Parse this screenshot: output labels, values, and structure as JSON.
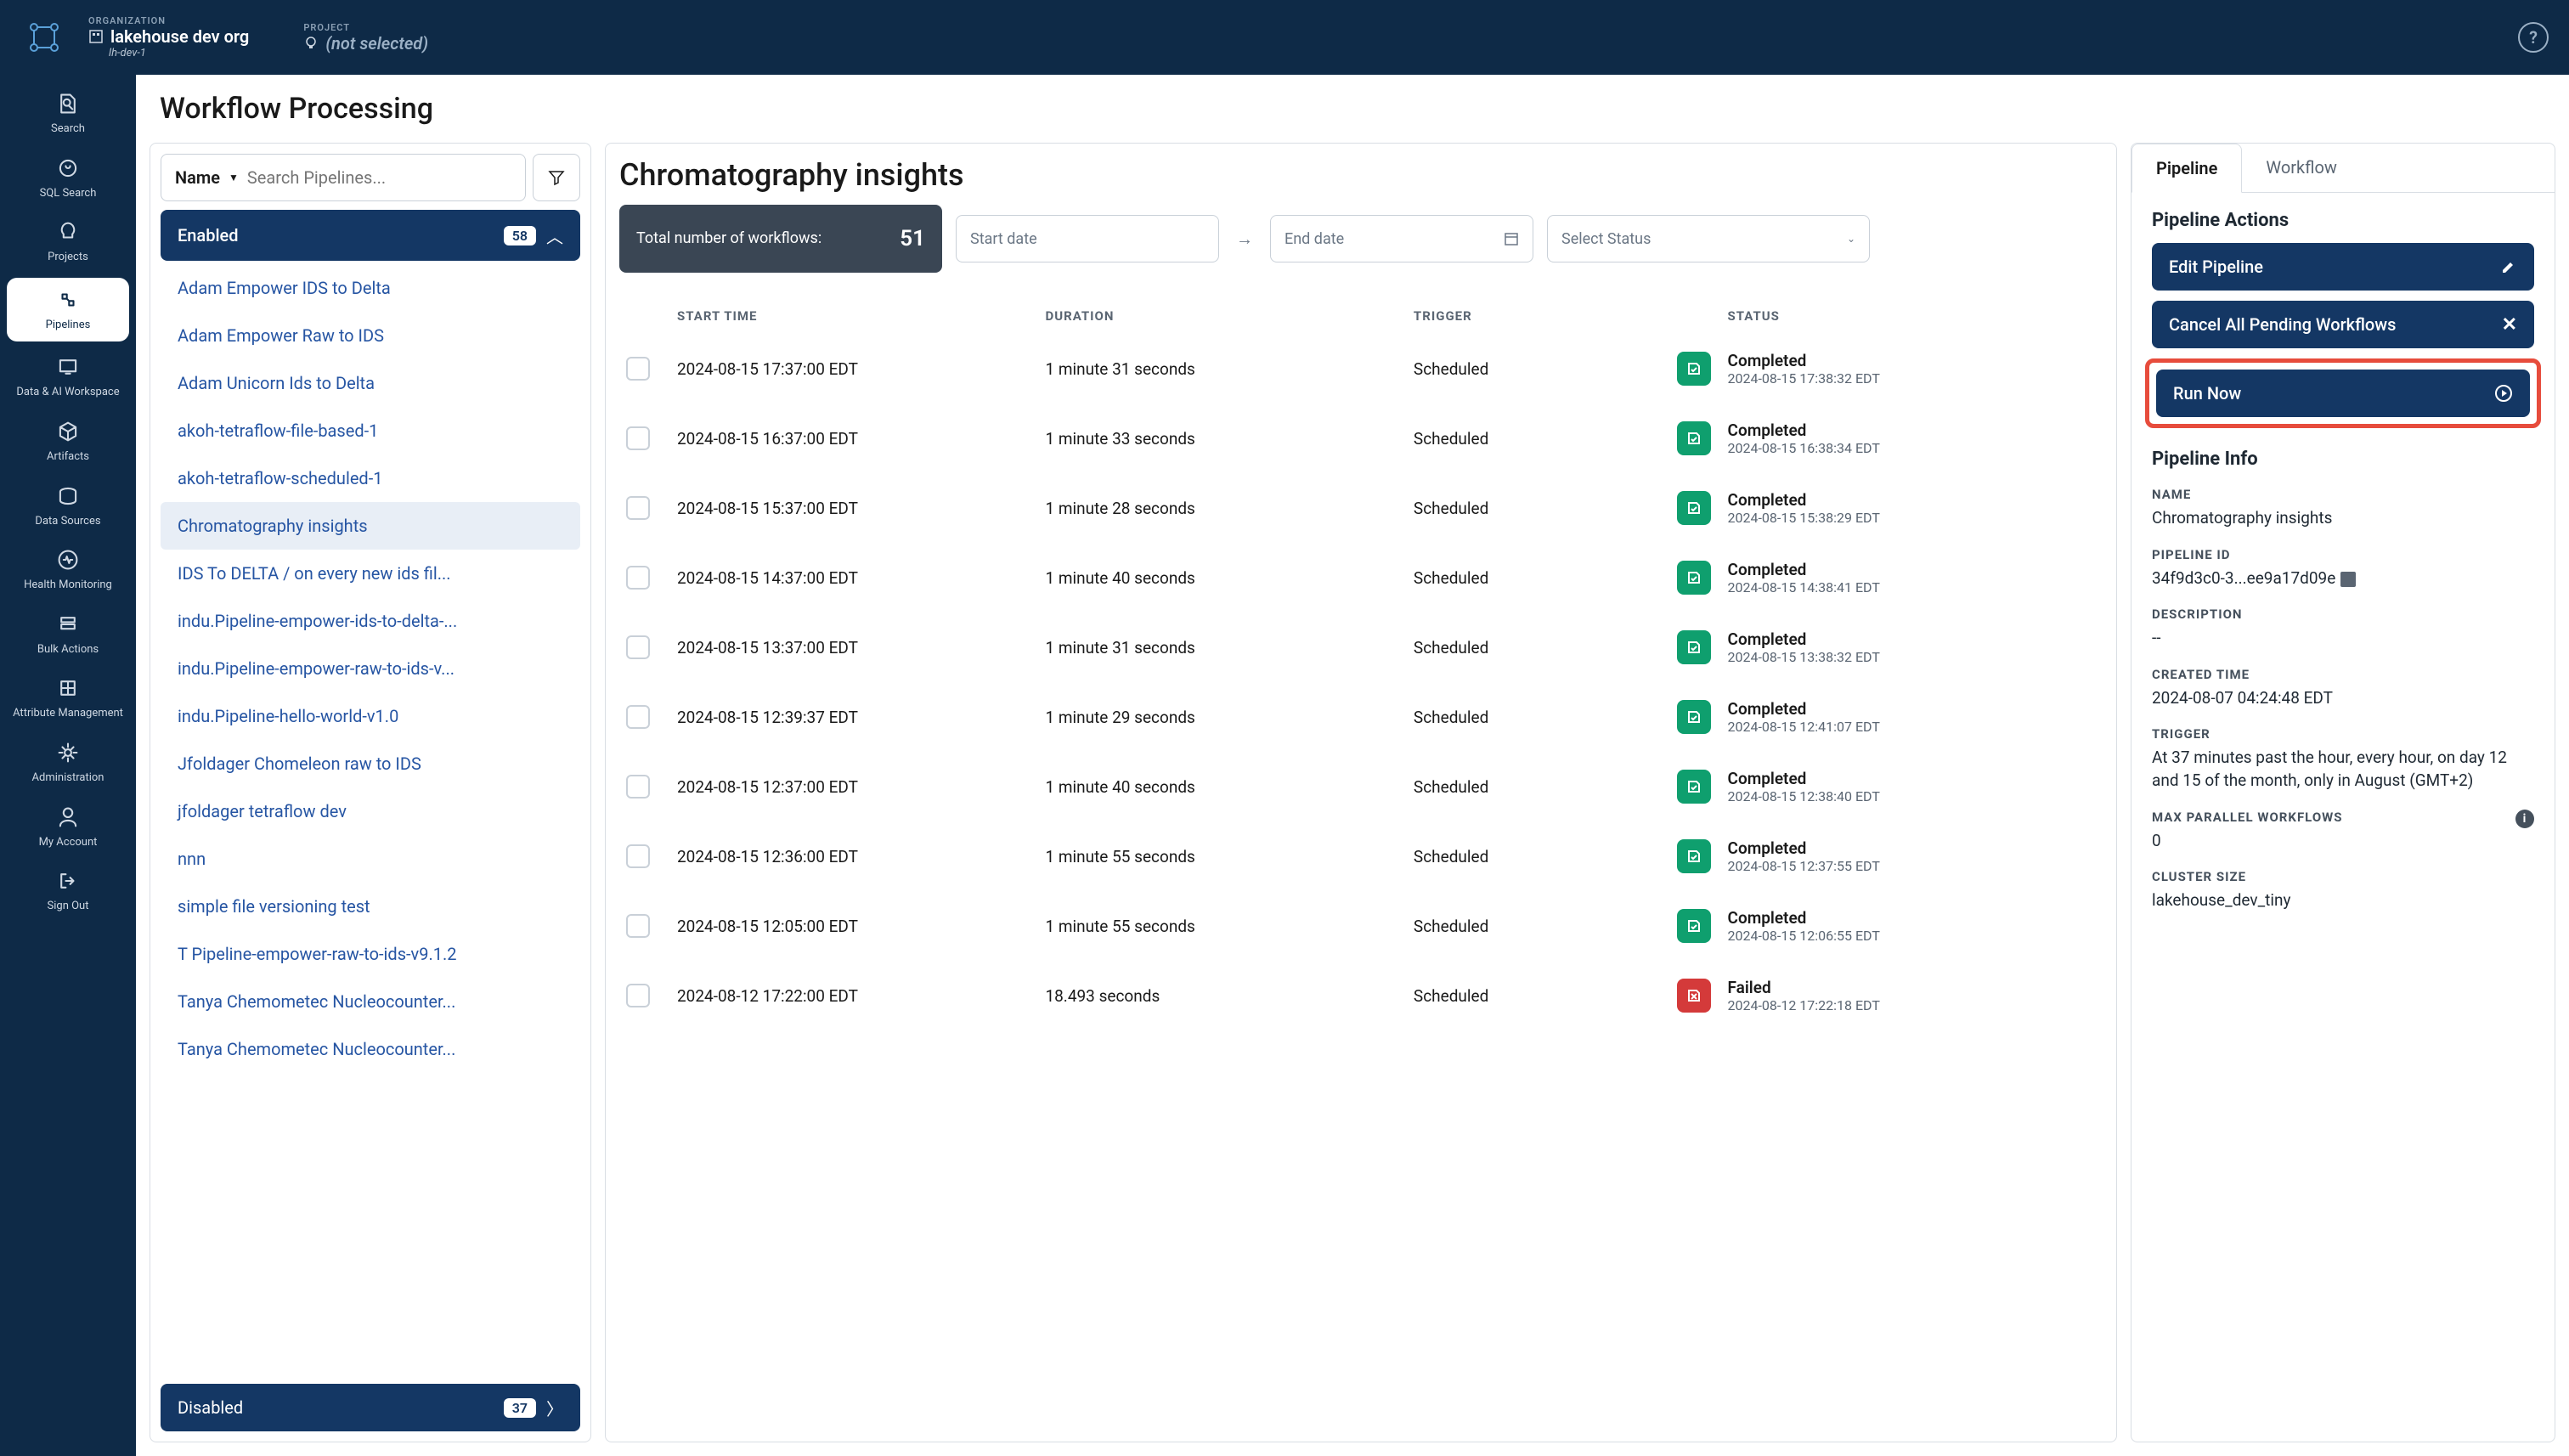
{
  "topbar": {
    "org_label": "ORGANIZATION",
    "org_name": "lakehouse dev org",
    "org_sub": "lh-dev-1",
    "project_label": "PROJECT",
    "project_value": "(not selected)"
  },
  "sidebar": {
    "items": [
      {
        "label": "Search",
        "icon": "file-search"
      },
      {
        "label": "SQL Search",
        "icon": "sql"
      },
      {
        "label": "Projects",
        "icon": "bulb"
      },
      {
        "label": "Pipelines",
        "icon": "pipeline",
        "active": true
      },
      {
        "label": "Data & AI Workspace",
        "icon": "monitor"
      },
      {
        "label": "Artifacts",
        "icon": "cube"
      },
      {
        "label": "Data Sources",
        "icon": "db"
      },
      {
        "label": "Health Monitoring",
        "icon": "health"
      },
      {
        "label": "Bulk Actions",
        "icon": "bulk"
      },
      {
        "label": "Attribute Management",
        "icon": "attr"
      },
      {
        "label": "Administration",
        "icon": "gear"
      },
      {
        "label": "My Account",
        "icon": "user"
      },
      {
        "label": "Sign Out",
        "icon": "signout"
      }
    ]
  },
  "page": {
    "title": "Workflow Processing"
  },
  "pipelines_panel": {
    "filter_label": "Name",
    "search_placeholder": "Search Pipelines...",
    "enabled_label": "Enabled",
    "enabled_count": "58",
    "disabled_label": "Disabled",
    "disabled_count": "37",
    "items": [
      "Adam Empower IDS to Delta",
      "Adam Empower Raw to IDS",
      "Adam Unicorn Ids to Delta",
      "akoh-tetraflow-file-based-1",
      "akoh-tetraflow-scheduled-1",
      "Chromatography insights",
      "IDS To DELTA / on every new ids fil...",
      "indu.Pipeline-empower-ids-to-delta-...",
      "indu.Pipeline-empower-raw-to-ids-v...",
      "indu.Pipeline-hello-world-v1.0",
      "Jfoldager Chomeleon raw to IDS",
      "jfoldager tetraflow dev",
      "nnn",
      "simple file versioning test",
      "T Pipeline-empower-raw-to-ids-v9.1.2",
      "Tanya Chemometec Nucleocounter...",
      "Tanya Chemometec Nucleocounter..."
    ],
    "selected_index": 5
  },
  "workflow_panel": {
    "title": "Chromatography insights",
    "count_label": "Total number of workflows:",
    "count_value": "51",
    "start_placeholder": "Start date",
    "end_placeholder": "End date",
    "status_placeholder": "Select Status",
    "columns": {
      "start": "START TIME",
      "duration": "DURATION",
      "trigger": "TRIGGER",
      "status": "STATUS"
    },
    "rows": [
      {
        "start": "2024-08-15 17:37:00 EDT",
        "duration": "1 minute 31 seconds",
        "trigger": "Scheduled",
        "status": "Completed",
        "status_time": "2024-08-15 17:38:32 EDT",
        "ok": true
      },
      {
        "start": "2024-08-15 16:37:00 EDT",
        "duration": "1 minute 33 seconds",
        "trigger": "Scheduled",
        "status": "Completed",
        "status_time": "2024-08-15 16:38:34 EDT",
        "ok": true
      },
      {
        "start": "2024-08-15 15:37:00 EDT",
        "duration": "1 minute 28 seconds",
        "trigger": "Scheduled",
        "status": "Completed",
        "status_time": "2024-08-15 15:38:29 EDT",
        "ok": true
      },
      {
        "start": "2024-08-15 14:37:00 EDT",
        "duration": "1 minute 40 seconds",
        "trigger": "Scheduled",
        "status": "Completed",
        "status_time": "2024-08-15 14:38:41 EDT",
        "ok": true
      },
      {
        "start": "2024-08-15 13:37:00 EDT",
        "duration": "1 minute 31 seconds",
        "trigger": "Scheduled",
        "status": "Completed",
        "status_time": "2024-08-15 13:38:32 EDT",
        "ok": true
      },
      {
        "start": "2024-08-15 12:39:37 EDT",
        "duration": "1 minute 29 seconds",
        "trigger": "Scheduled",
        "status": "Completed",
        "status_time": "2024-08-15 12:41:07 EDT",
        "ok": true
      },
      {
        "start": "2024-08-15 12:37:00 EDT",
        "duration": "1 minute 40 seconds",
        "trigger": "Scheduled",
        "status": "Completed",
        "status_time": "2024-08-15 12:38:40 EDT",
        "ok": true
      },
      {
        "start": "2024-08-15 12:36:00 EDT",
        "duration": "1 minute 55 seconds",
        "trigger": "Scheduled",
        "status": "Completed",
        "status_time": "2024-08-15 12:37:55 EDT",
        "ok": true
      },
      {
        "start": "2024-08-15 12:05:00 EDT",
        "duration": "1 minute 55 seconds",
        "trigger": "Scheduled",
        "status": "Completed",
        "status_time": "2024-08-15 12:06:55 EDT",
        "ok": true
      },
      {
        "start": "2024-08-12 17:22:00 EDT",
        "duration": "18.493 seconds",
        "trigger": "Scheduled",
        "status": "Failed",
        "status_time": "2024-08-12 17:22:18 EDT",
        "ok": false
      }
    ]
  },
  "details_panel": {
    "tabs": {
      "pipeline": "Pipeline",
      "workflow": "Workflow"
    },
    "actions_heading": "Pipeline Actions",
    "edit_label": "Edit Pipeline",
    "cancel_label": "Cancel All Pending Workflows",
    "run_label": "Run Now",
    "info_heading": "Pipeline Info",
    "name_label": "NAME",
    "name_value": "Chromatography insights",
    "id_label": "PIPELINE ID",
    "id_value": "34f9d3c0-3...ee9a17d09e",
    "desc_label": "DESCRIPTION",
    "desc_value": "--",
    "created_label": "CREATED TIME",
    "created_value": "2024-08-07 04:24:48 EDT",
    "trigger_label": "TRIGGER",
    "trigger_value": "At 37 minutes past the hour, every hour, on day 12 and 15 of the month, only in August (GMT+2)",
    "max_label": "MAX PARALLEL WORKFLOWS",
    "max_value": "0",
    "cluster_label": "CLUSTER SIZE",
    "cluster_value": "lakehouse_dev_tiny"
  }
}
